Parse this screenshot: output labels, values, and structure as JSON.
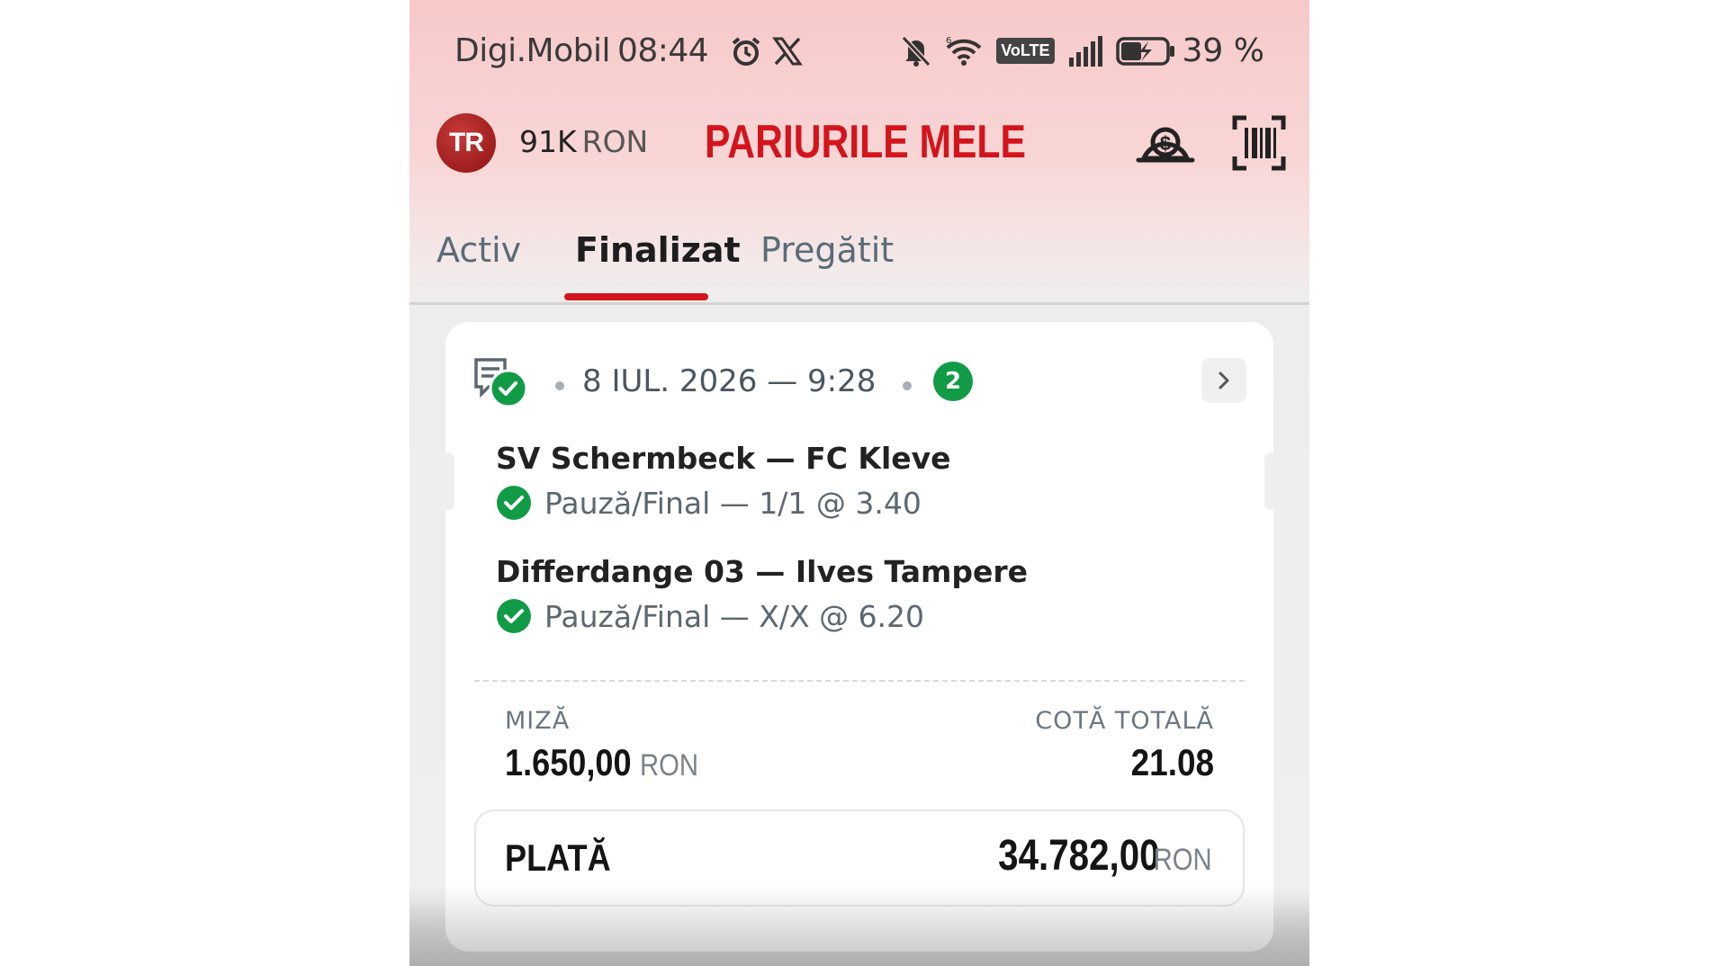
{
  "status_bar": {
    "carrier": "Digi.Mobil",
    "time": "08:44",
    "battery": "39 %",
    "volte": "VoLTE"
  },
  "header": {
    "avatar_initials": "TR",
    "balance_value": "91K",
    "balance_currency": "RON",
    "title": "PARIURILE MELE"
  },
  "tabs": [
    {
      "label": "Activ"
    },
    {
      "label": "Finalizat"
    },
    {
      "label": "Pregătit"
    }
  ],
  "bet": {
    "datetime": "8 IUL. 2026 — 9:28",
    "selections_count": "2",
    "selections": [
      {
        "match": "SV Schermbeck — FC Kleve",
        "pick": "Pauză/Final — 1/1 @ 3.40"
      },
      {
        "match": "Differdange 03 — Ilves Tampere",
        "pick": "Pauză/Final — X/X @ 6.20"
      }
    ],
    "stake_label": "MIZĂ",
    "stake_value": "1.650,00",
    "stake_currency": "RON",
    "total_odds_label": "COTĂ TOTALĂ",
    "total_odds_value": "21.08",
    "payout_label": "PLATĂ",
    "payout_value": "34.782,00",
    "payout_currency": "RON"
  },
  "colors": {
    "brand_red": "#d4141c",
    "success_green": "#129b46"
  },
  "icons": [
    "alarm-icon",
    "x-logo-icon",
    "bell-muted-icon",
    "wifi-icon",
    "signal-icon",
    "battery-charging-icon",
    "cash-out-icon",
    "barcode-scan-icon",
    "ticket-check-icon",
    "chevron-right-icon",
    "check-circle-icon"
  ]
}
